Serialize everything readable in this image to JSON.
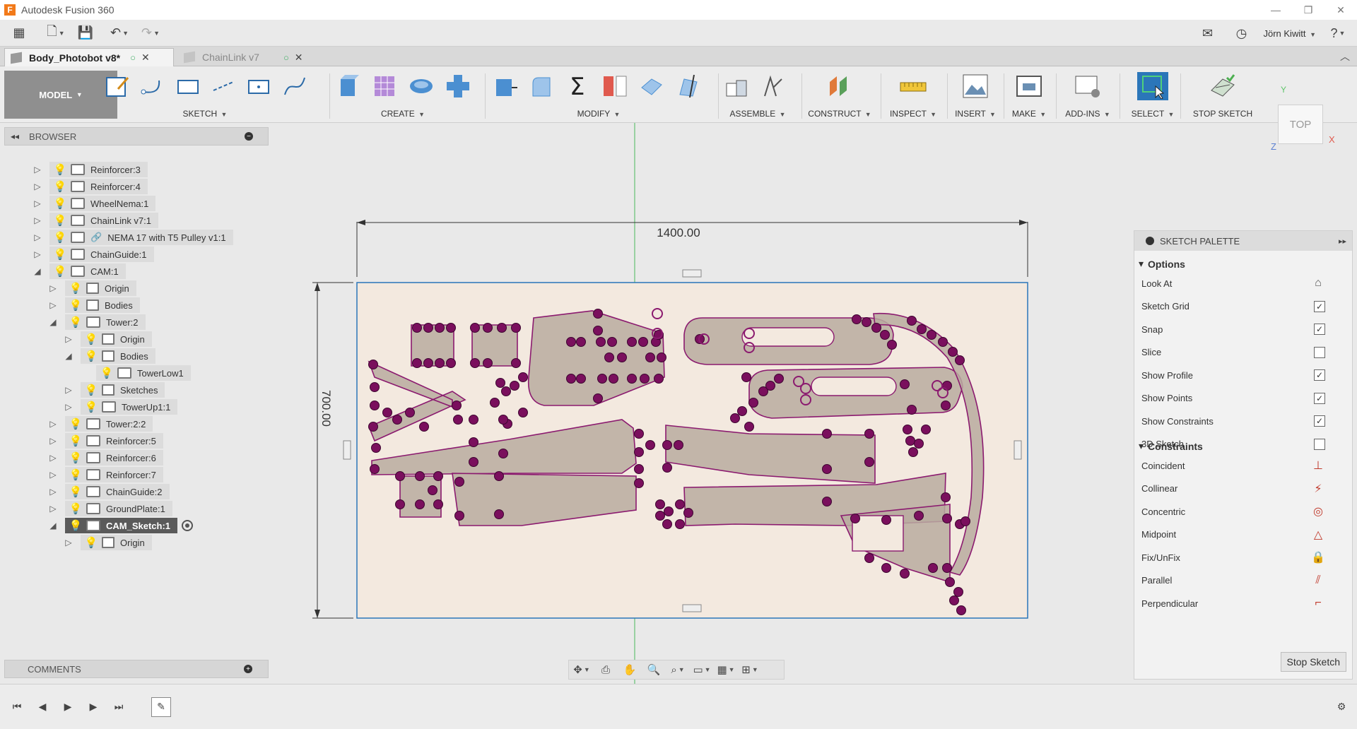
{
  "window": {
    "title": "Autodesk Fusion 360",
    "minimize": "—",
    "maximize": "❐",
    "close": "✕"
  },
  "quickaccess": {
    "user": "Jörn Kiwitt"
  },
  "tabs": [
    {
      "label": "Body_Photobot v8*"
    },
    {
      "label": "ChainLink v7"
    }
  ],
  "toolbar": {
    "workspace": "MODEL",
    "groups": [
      "SKETCH",
      "CREATE",
      "MODIFY",
      "ASSEMBLE",
      "CONSTRUCT",
      "INSPECT",
      "INSERT",
      "MAKE",
      "ADD-INS",
      "SELECT",
      "STOP SKETCH"
    ]
  },
  "viewcube": {
    "label": "TOP",
    "axis_y": "Y",
    "axis_x": "X",
    "axis_z": "Z"
  },
  "browser": {
    "title": "BROWSER",
    "items": [
      {
        "label": "Reinforcer:3"
      },
      {
        "label": "Reinforcer:4"
      },
      {
        "label": "WheelNema:1"
      },
      {
        "label": "ChainLink v7:1"
      },
      {
        "label": "NEMA 17 with T5 Pulley v1:1"
      },
      {
        "label": "ChainGuide:1"
      },
      {
        "label": "CAM:1"
      },
      {
        "label": "Origin"
      },
      {
        "label": "Bodies"
      },
      {
        "label": "Tower:2"
      },
      {
        "label": "Origin"
      },
      {
        "label": "Bodies"
      },
      {
        "label": "TowerLow1"
      },
      {
        "label": "Sketches"
      },
      {
        "label": "TowerUp1:1"
      },
      {
        "label": "Tower:2:2"
      },
      {
        "label": "Reinforcer:5"
      },
      {
        "label": "Reinforcer:6"
      },
      {
        "label": "Reinforcer:7"
      },
      {
        "label": "ChainGuide:2"
      },
      {
        "label": "GroundPlate:1"
      },
      {
        "label": "CAM_Sketch:1"
      },
      {
        "label": "Origin"
      }
    ]
  },
  "comments": {
    "title": "COMMENTS"
  },
  "sketch": {
    "dim_width": "1400.00",
    "dim_height": "700.00"
  },
  "palette": {
    "title": "SKETCH PALETTE",
    "options_title": "Options",
    "options": [
      {
        "label": "Look At"
      },
      {
        "label": "Sketch Grid",
        "checked": true
      },
      {
        "label": "Snap",
        "checked": true
      },
      {
        "label": "Slice",
        "checked": false
      },
      {
        "label": "Show Profile",
        "checked": true
      },
      {
        "label": "Show Points",
        "checked": true
      },
      {
        "label": "Show Constraints",
        "checked": true
      },
      {
        "label": "3D Sketch",
        "checked": false
      }
    ],
    "constraints_title": "Constraints",
    "constraints": [
      {
        "label": "Coincident",
        "icon": "coincident-icon"
      },
      {
        "label": "Collinear",
        "icon": "collinear-icon"
      },
      {
        "label": "Concentric",
        "icon": "concentric-icon"
      },
      {
        "label": "Midpoint",
        "icon": "midpoint-icon"
      },
      {
        "label": "Fix/UnFix",
        "icon": "lock-icon"
      },
      {
        "label": "Parallel",
        "icon": "parallel-icon"
      },
      {
        "label": "Perpendicular",
        "icon": "perpendicular-icon"
      }
    ],
    "stop_button": "Stop Sketch"
  },
  "colors": {
    "accent": "#2b76b9",
    "sketch_fill": "#b9aca0",
    "sketch_line": "#8b1a6f",
    "sheet": "#f3e9df"
  }
}
